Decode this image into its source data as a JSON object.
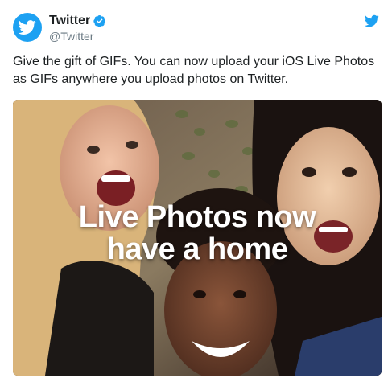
{
  "tweet": {
    "author": {
      "name": "Twitter",
      "handle": "@Twitter",
      "verified": true,
      "avatar_icon": "twitter-bird-icon"
    },
    "text": "Give the gift of GIFs. You can now upload your iOS Live Photos as GIFs anywhere you upload photos on Twitter.",
    "media": {
      "overlay_line1": "Live Photos now",
      "overlay_line2": "have a home"
    },
    "brand_icon": "twitter-bird-icon"
  },
  "colors": {
    "brand": "#1da1f2",
    "text": "#1c2022",
    "secondary_text": "#697882"
  }
}
